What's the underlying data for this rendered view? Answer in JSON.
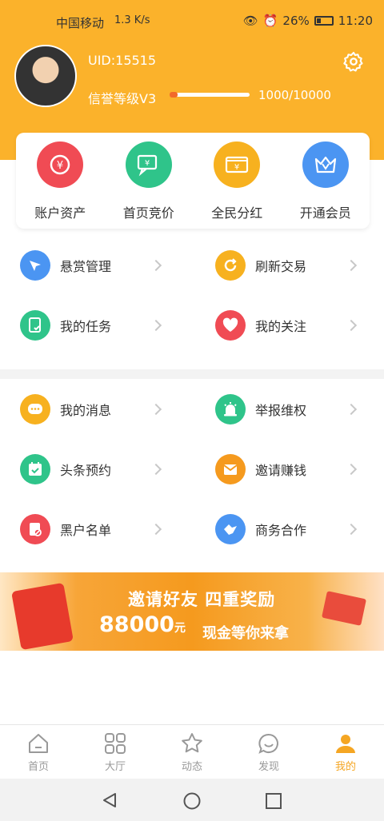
{
  "status_bar": {
    "carrier": "中国移动",
    "signal_text": "1.3 K/s",
    "battery": "26%",
    "time": "11:20"
  },
  "profile": {
    "uid": "UID:15515",
    "level_label": "信誉等级V3",
    "progress_text": "1000/10000",
    "progress": 0.1
  },
  "quick_actions": [
    {
      "label": "账户资产",
      "icon": "yuan-coin-icon",
      "color": "#f04b54"
    },
    {
      "label": "首页竞价",
      "icon": "chat-yuan-icon",
      "color": "#2fc48a"
    },
    {
      "label": "全民分红",
      "icon": "wallet-icon",
      "color": "#f7b11f"
    },
    {
      "label": "开通会员",
      "icon": "crown-icon",
      "color": "#4b95f2"
    }
  ],
  "menu_group1": [
    {
      "label": "悬赏管理",
      "icon": "send-icon",
      "color": "#4b95f2"
    },
    {
      "label": "刷新交易",
      "icon": "refresh-icon",
      "color": "#f7b11f"
    },
    {
      "label": "我的任务",
      "icon": "task-icon",
      "color": "#2fc48a"
    },
    {
      "label": "我的关注",
      "icon": "heart-icon",
      "color": "#f04b54"
    }
  ],
  "menu_group2": [
    {
      "label": "我的消息",
      "icon": "message-icon",
      "color": "#f7b11f"
    },
    {
      "label": "举报维权",
      "icon": "alarm-icon",
      "color": "#2fc48a"
    },
    {
      "label": "头条预约",
      "icon": "calendar-check-icon",
      "color": "#2fc48a"
    },
    {
      "label": "邀请赚钱",
      "icon": "envelope-icon",
      "color": "#f59a1e"
    },
    {
      "label": "黑户名单",
      "icon": "blocked-doc-icon",
      "color": "#f04b54"
    },
    {
      "label": "商务合作",
      "icon": "handshake-icon",
      "color": "#4b95f2"
    }
  ],
  "banner": {
    "line1": "邀请好友 四重奖励",
    "amount": "88000",
    "unit": "元",
    "line2": "现金等你来拿"
  },
  "tabs": [
    {
      "label": "首页",
      "icon": "home-icon",
      "active": false
    },
    {
      "label": "大厅",
      "icon": "grid-icon",
      "active": false
    },
    {
      "label": "动态",
      "icon": "star-icon",
      "active": false
    },
    {
      "label": "发现",
      "icon": "chat-bubble-icon",
      "active": false
    },
    {
      "label": "我的",
      "icon": "person-icon",
      "active": true
    }
  ],
  "colors": {
    "brand": "#fbb22b",
    "active_tab": "#f5a623"
  }
}
